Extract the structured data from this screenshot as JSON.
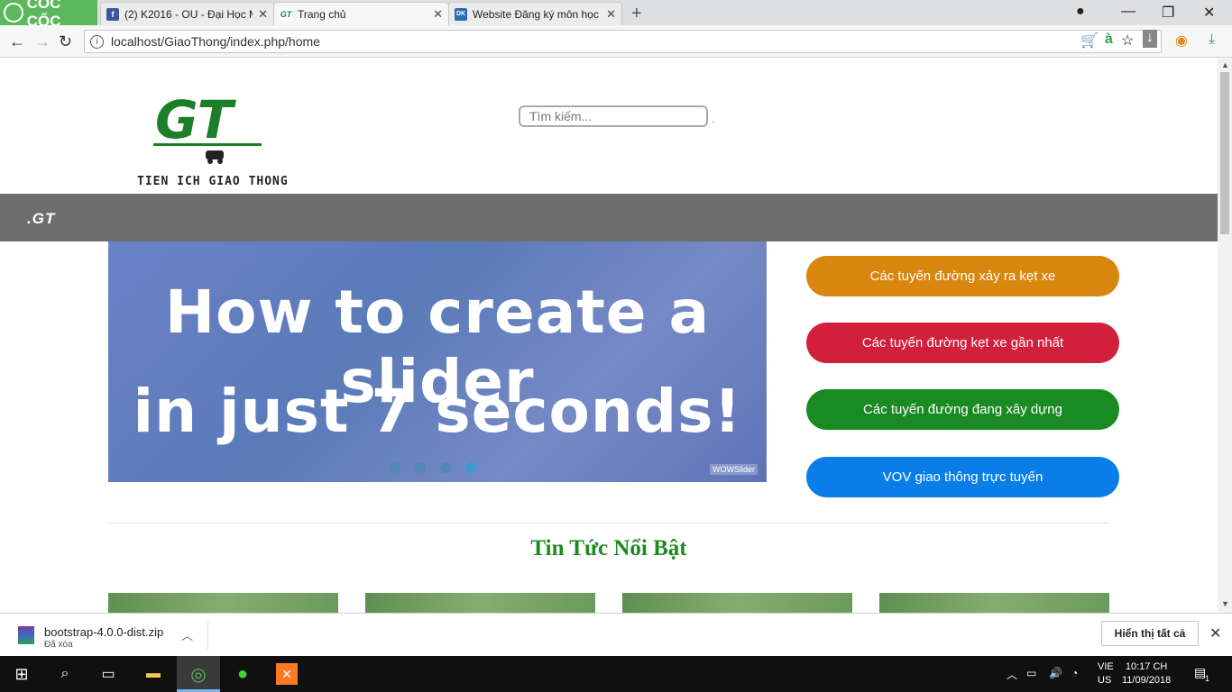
{
  "browser": {
    "brand": "CỐC CỐC",
    "tabs": [
      {
        "title": "(2) K2016 - OU - Đại Học M",
        "favicon": "facebook-icon",
        "color": "#3b5998"
      },
      {
        "title": "Trang chủ",
        "favicon": "gt-icon",
        "color": "#1b7f2a",
        "active": true
      },
      {
        "title": "Website Đăng ký môn học",
        "favicon": "dkmh-icon",
        "color": "#2a6fb0"
      }
    ],
    "url": "localhost/GiaoThong/index.php/home"
  },
  "site": {
    "logo_letters": "GT",
    "logo_tagline": "TIEN ICH GIAO THONG",
    "search_placeholder": "Tìm kiếm...",
    "menu_logo": ".GT",
    "slider": {
      "line1": "How to create a slider",
      "line2": "in just 7 seconds!",
      "watermark": "WOWSlider",
      "dot_count": 4
    },
    "quick_links": [
      {
        "label": "Các tuyến đường xảy ra kẹt xe",
        "color": "#d9860f"
      },
      {
        "label": "Các tuyến đường kẹt xe gần nhất",
        "color": "#d21f3c"
      },
      {
        "label": "Các tuyến đường đang xây dựng",
        "color": "#1a8a22"
      },
      {
        "label": "VOV giao thông trực tuyến",
        "color": "#0a7de8"
      }
    ],
    "section_title": "Tin Tức Nổi Bật"
  },
  "downloads": {
    "file": "bootstrap-4.0.0-dist.zip",
    "status": "Đã xóa",
    "show_all": "Hiển thị tất cả"
  },
  "taskbar": {
    "lang1": "VIE",
    "lang2": "US",
    "time": "10:17 CH",
    "date": "11/09/2018",
    "notifications": "1"
  }
}
